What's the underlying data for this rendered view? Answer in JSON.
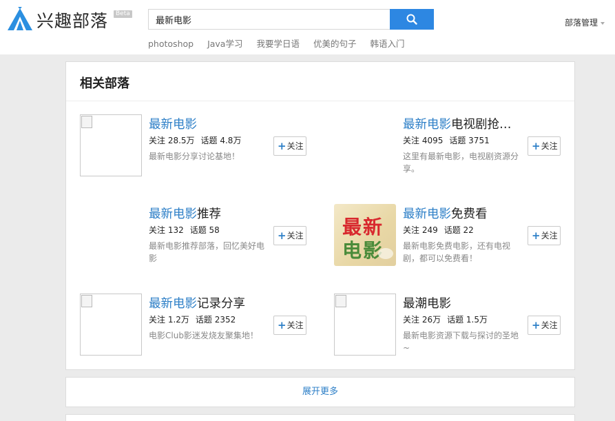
{
  "header": {
    "brand": "兴趣部落",
    "beta": "Beta",
    "search_value": "最新电影",
    "hotwords": [
      "photoshop",
      "Java学习",
      "我要学日语",
      "优美的句子",
      "韩语入门"
    ],
    "admin_label": "部落管理"
  },
  "panel": {
    "title": "相关部落",
    "follow_label": "关注",
    "tribes": [
      {
        "title_hl": "最新电影",
        "title_rest": "",
        "follow": "关注 28.5万",
        "topics": "话题 4.8万",
        "desc": "最新电影分享讨论基地！",
        "thumb": "broken"
      },
      {
        "title_hl": "最新电影",
        "title_rest": "电视剧抢…",
        "follow": "关注 4095",
        "topics": "话题 3751",
        "desc": "这里有最新电影，电视剧资源分享。",
        "thumb": "none"
      },
      {
        "title_hl": "最新电影",
        "title_rest": "推荐",
        "follow": "关注 132",
        "topics": "话题 58",
        "desc": "最新电影推荐部落，回忆美好电影",
        "thumb": "none"
      },
      {
        "title_hl": "最新电影",
        "title_rest": "免费看",
        "follow": "关注 249",
        "topics": "话题 22",
        "desc": "最新电影免费电影，还有电视剧，都可以免费看！",
        "thumb": "poster",
        "poster_line1": "最新",
        "poster_line2": "电影"
      },
      {
        "title_hl": "最新电影",
        "title_rest": "记录分享",
        "follow": "关注 1.2万",
        "topics": "话题 2352",
        "desc": "电影Club影迷发烧友聚集地！",
        "thumb": "broken"
      },
      {
        "title_hl": "",
        "title_rest": "最潮电影",
        "follow": "关注 26万",
        "topics": "话题 1.5万",
        "desc": "最新电影资源下载与探讨的圣地~",
        "thumb": "broken"
      }
    ]
  },
  "more_label": "展开更多",
  "colors": {
    "accent": "#2d87e2",
    "link": "#2d7fc7"
  }
}
